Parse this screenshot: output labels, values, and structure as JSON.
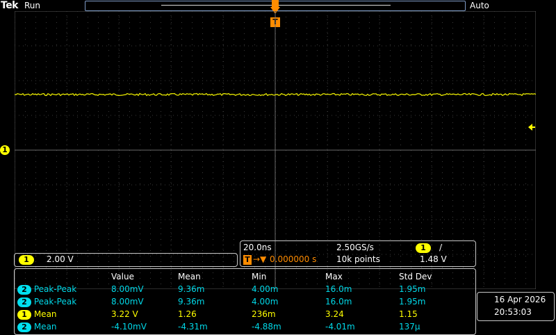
{
  "header": {
    "brand": "Tek",
    "run_state": "Run",
    "trigger_mode": "Auto"
  },
  "markers": {
    "trigger_top": "T",
    "channel_ground": "1"
  },
  "channel_box": {
    "channel": "1",
    "volts_div": "2.00 V"
  },
  "timebase": {
    "time_div": "20.0ns",
    "sample_rate": "2.50GS/s",
    "trigger_channel": "1",
    "trigger_slope": "/",
    "trigger_position_label": "T",
    "trigger_position_value": "0.000000 s",
    "record_length": "10k points",
    "trigger_level": "1.48 V"
  },
  "measurements": {
    "headers": [
      "Value",
      "Mean",
      "Min",
      "Max",
      "Std Dev"
    ],
    "rows": [
      {
        "ch": "2",
        "name": "Peak-Peak",
        "value": "8.00mV",
        "mean": "9.36m",
        "min": "4.00m",
        "max": "16.0m",
        "std": "1.95m"
      },
      {
        "ch": "2",
        "name": "Peak-Peak",
        "value": "8.00mV",
        "mean": "9.36m",
        "min": "4.00m",
        "max": "16.0m",
        "std": "1.95m"
      },
      {
        "ch": "1",
        "name": "Mean",
        "value": "3.22 V",
        "mean": "1.26",
        "min": "236m",
        "max": "3.24",
        "std": "1.15"
      },
      {
        "ch": "2",
        "name": "Mean",
        "value": "-4.10mV",
        "mean": "-4.31m",
        "min": "-4.88m",
        "max": "-4.01m",
        "std": "137μ"
      }
    ]
  },
  "clock": {
    "date": "16 Apr  2026",
    "time": "20:53:03"
  },
  "colors": {
    "ch1": "#ffff00",
    "ch2": "#00d8e8",
    "trigger": "#ff8c00",
    "grid": "#5a5a5a"
  }
}
